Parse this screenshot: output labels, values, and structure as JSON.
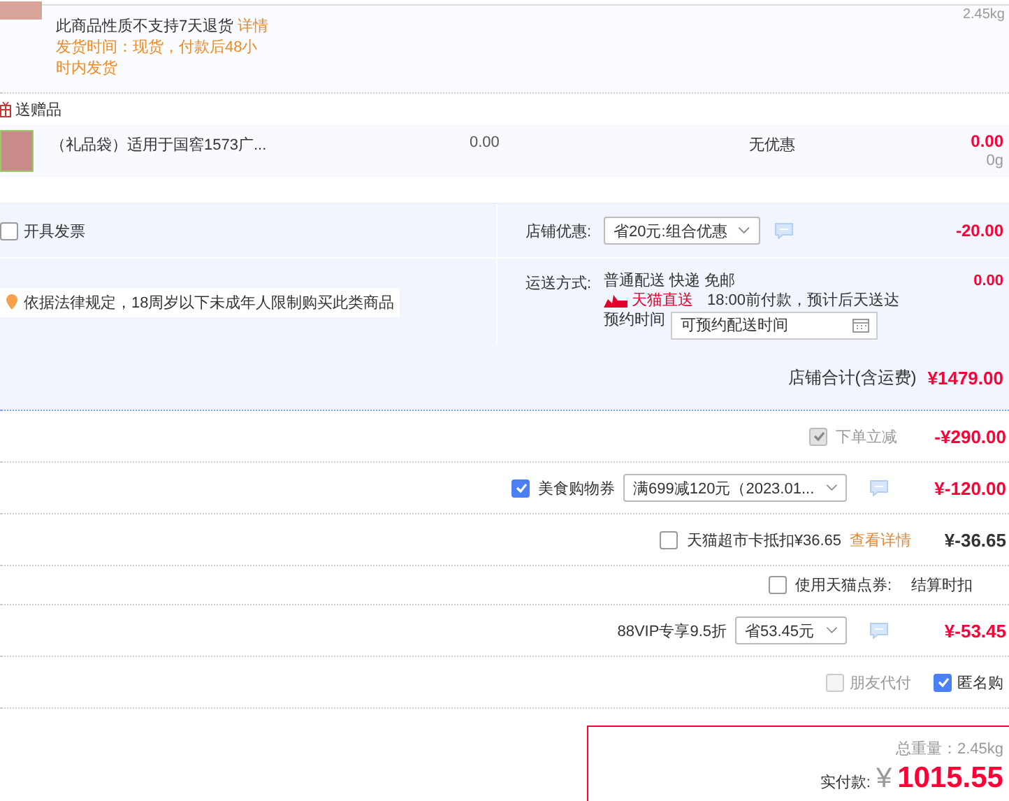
{
  "item": {
    "weight": "2.45kg",
    "notice": "此商品性质不支持7天退货",
    "notice_link": "详情",
    "shipping_time": "发货时间：现货，付款后48小时内发货"
  },
  "gift_section": {
    "title": "送赠品",
    "items": [
      {
        "name": "（礼品袋）适用于国窖1573广...",
        "price": "0.00",
        "discount": "无优惠",
        "subtotal": "0.00",
        "weight": "0g"
      }
    ]
  },
  "invoice": {
    "label": "开具发票",
    "checked": false
  },
  "age_notice": "依据法律规定，18周岁以下未成年人限制购买此类商品",
  "store_discount": {
    "label": "店铺优惠:",
    "value": "省20元:组合优惠",
    "amount": "-20.00"
  },
  "shipping": {
    "label": "运送方式:",
    "method": "普通配送 快递 免邮",
    "badge": "天猫直送",
    "eta": "18:00前付款，预计后天送达",
    "schedule_label": "预约时间",
    "schedule_placeholder": "可预约配送时间",
    "amount": "0.00"
  },
  "store_total": {
    "label": "店铺合计(含运费)",
    "amount": "¥1479.00"
  },
  "discounts": [
    {
      "kind": "check",
      "label": "下单立减",
      "checked": true,
      "disabled": true,
      "amount": "-¥290.00"
    },
    {
      "kind": "coupon",
      "label": "美食购物券",
      "checked": true,
      "disabled": false,
      "value": "满699减120元（2023.01...",
      "amount": "¥-120.00"
    },
    {
      "kind": "card",
      "label": "天猫超市卡抵扣¥36.65",
      "checked": false,
      "disabled": false,
      "link": "查看详情",
      "amount": "¥-36.65"
    },
    {
      "kind": "points",
      "label": "使用天猫点券:",
      "checked": false,
      "disabled": false,
      "note": "结算时扣"
    },
    {
      "kind": "vip",
      "label": "88VIP专享9.5折",
      "value": "省53.45元",
      "amount": "¥-53.45"
    }
  ],
  "options": [
    {
      "label": "朋友代付",
      "checked": false,
      "disabled": true
    },
    {
      "label": "匿名购",
      "checked": true,
      "disabled": false
    }
  ],
  "total": {
    "weight": "总重量：2.45kg",
    "pay_label": "实付款:",
    "currency": "¥",
    "amount": "1015.55"
  }
}
